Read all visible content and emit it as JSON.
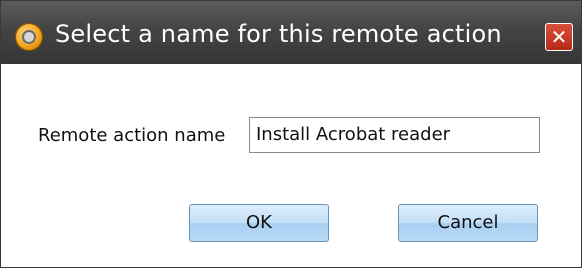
{
  "window": {
    "title": "Select a name for this remote action",
    "close_label": "✕"
  },
  "form": {
    "label": "Remote action name",
    "input_value": "Install Acrobat reader"
  },
  "buttons": {
    "ok_label": "OK",
    "cancel_label": "Cancel"
  },
  "icons": {
    "app": "app-logo-icon",
    "close": "close-icon"
  },
  "colors": {
    "titlebar": "#444444",
    "close_button": "#c0392b",
    "button_fill": "#c4e0f8",
    "button_border": "#6c94b8"
  }
}
